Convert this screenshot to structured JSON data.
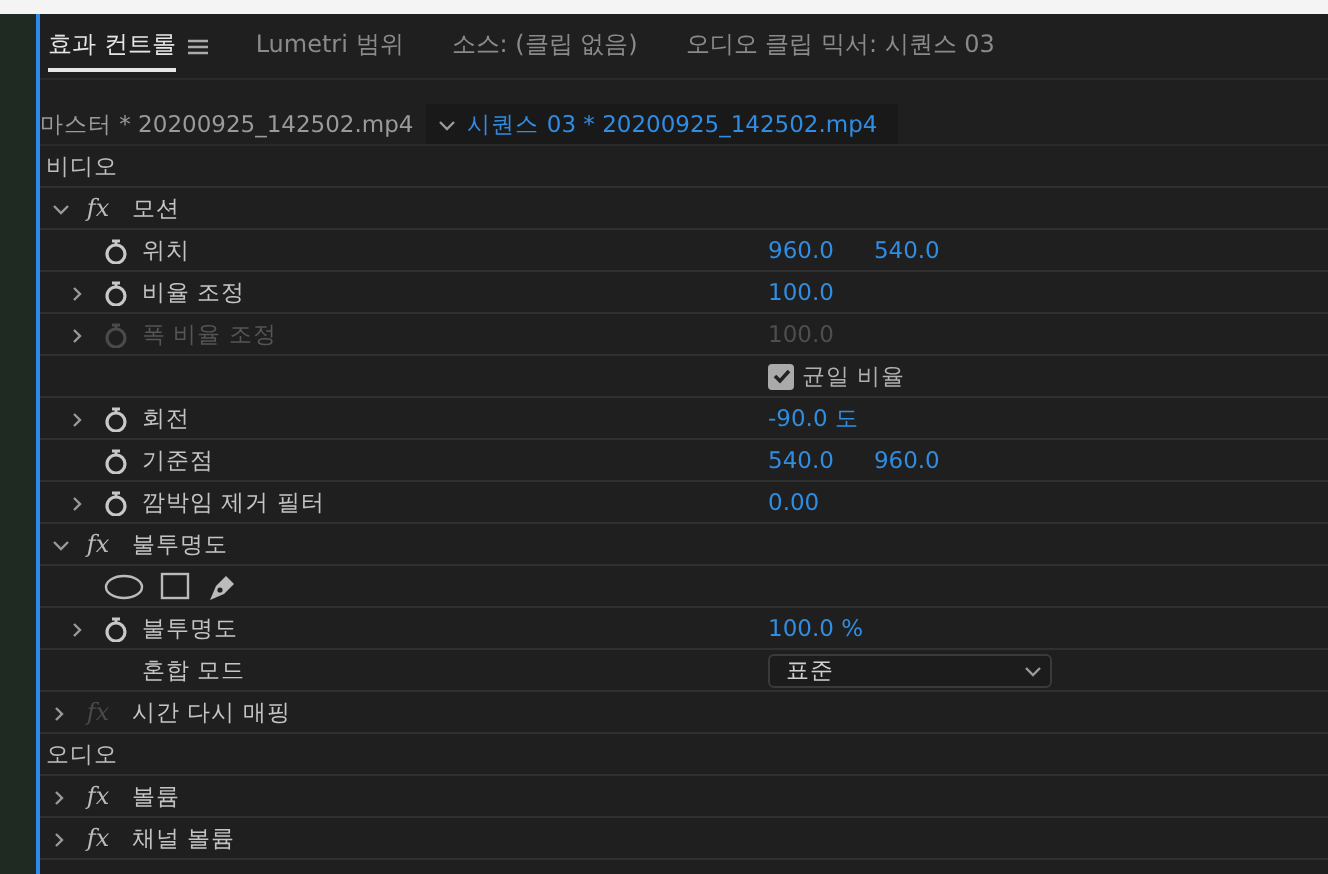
{
  "tabs": [
    {
      "label": "효과 컨트롤",
      "selected": true,
      "menu": true
    },
    {
      "label": "Lumetri 범위",
      "selected": false,
      "menu": false
    },
    {
      "label": "소스: (클립 없음)",
      "selected": false,
      "menu": false
    },
    {
      "label": "오디오 클립 믹서: 시퀀스 03",
      "selected": false,
      "menu": false
    }
  ],
  "clip_bar": {
    "master": "마스터 * 20200925_142502.mp4",
    "sequence": "시퀀스 03 * 20200925_142502.mp4"
  },
  "sections": [
    {
      "label": "비디오",
      "effects": [
        {
          "name": "모션",
          "fx": "fx",
          "expanded": true,
          "enabled": true,
          "children": [
            {
              "kind": "value",
              "name": "위치",
              "expandable": false,
              "disabled": false,
              "values": [
                "960.0",
                "540.0"
              ]
            },
            {
              "kind": "value",
              "name": "비율 조정",
              "expandable": true,
              "disabled": false,
              "values": [
                "100.0"
              ]
            },
            {
              "kind": "value",
              "name": "폭 비율 조정",
              "expandable": true,
              "disabled": true,
              "values": [
                "100.0"
              ]
            },
            {
              "kind": "checkbox",
              "label": "균일 비율",
              "checked": true
            },
            {
              "kind": "value",
              "name": "회전",
              "expandable": true,
              "disabled": false,
              "values": [
                "-90.0 도"
              ]
            },
            {
              "kind": "value",
              "name": "기준점",
              "expandable": false,
              "disabled": false,
              "values": [
                "540.0",
                "960.0"
              ]
            },
            {
              "kind": "value",
              "name": "깜박임 제거 필터",
              "expandable": true,
              "disabled": false,
              "values": [
                "0.00"
              ]
            }
          ]
        },
        {
          "name": "불투명도",
          "fx": "fx",
          "expanded": true,
          "enabled": true,
          "children": [
            {
              "kind": "mask-tools"
            },
            {
              "kind": "value",
              "name": "불투명도",
              "expandable": true,
              "disabled": false,
              "values": [
                "100.0 %"
              ]
            },
            {
              "kind": "dropdown",
              "name": "혼합 모드",
              "value": "표준"
            }
          ]
        },
        {
          "name": "시간 다시 매핑",
          "fx": "fx",
          "expanded": false,
          "enabled": false
        }
      ]
    },
    {
      "label": "오디오",
      "effects": [
        {
          "name": "볼륨",
          "fx": "fx",
          "expanded": false,
          "enabled": true
        },
        {
          "name": "채널 볼륨",
          "fx": "fx",
          "expanded": false,
          "enabled": true
        }
      ]
    }
  ]
}
